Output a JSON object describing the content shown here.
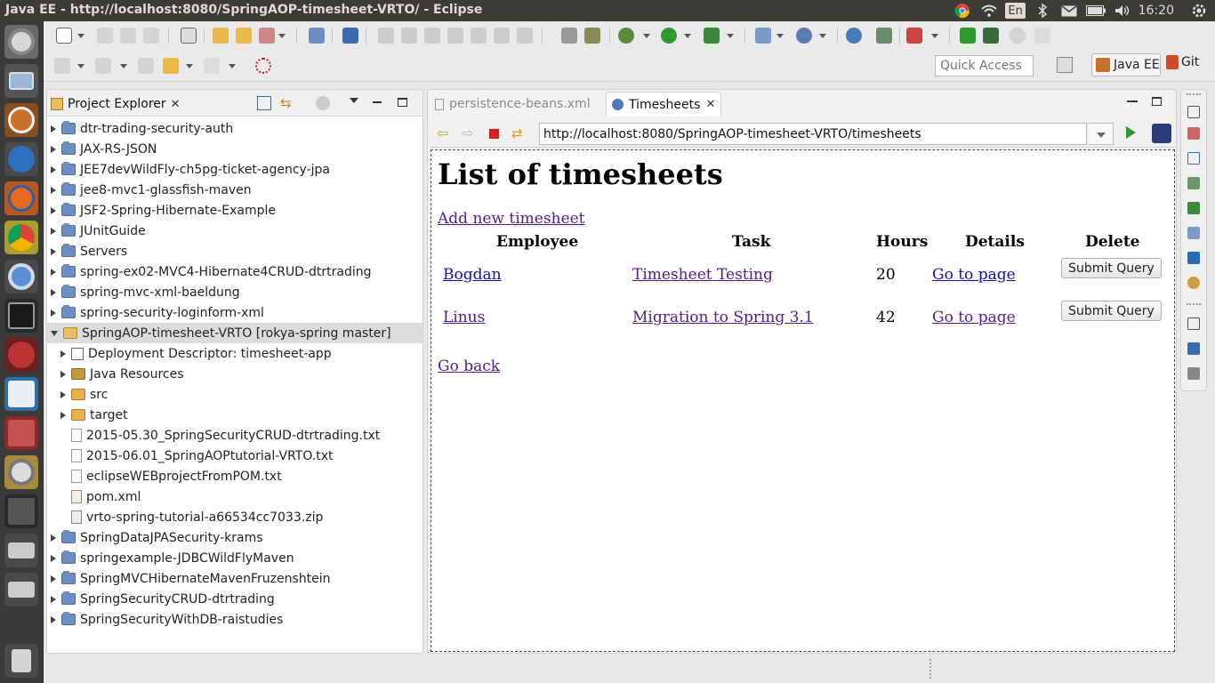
{
  "window": {
    "title": "Java EE - http://localhost:8080/SpringAOP-timesheet-VRTO/ - Eclipse"
  },
  "system_tray": {
    "keyboard_layout": "En",
    "clock": "16:20"
  },
  "toolbar": {
    "quick_access_placeholder": "Quick Access",
    "perspectives": [
      {
        "label": "Java EE",
        "active": true
      },
      {
        "label": "Git",
        "active": false
      }
    ]
  },
  "project_explorer": {
    "title": "Project Explorer",
    "items": [
      {
        "label": "dtr-trading-security-auth",
        "icon": "folder",
        "depth": 0,
        "expand": "closed"
      },
      {
        "label": "JAX-RS-JSON",
        "icon": "folder",
        "depth": 0,
        "expand": "closed"
      },
      {
        "label": "JEE7devWildFly-ch5pg-ticket-agency-jpa",
        "icon": "folder",
        "depth": 0,
        "expand": "closed"
      },
      {
        "label": "jee8-mvc1-glassfish-maven",
        "icon": "folder",
        "depth": 0,
        "expand": "closed"
      },
      {
        "label": "JSF2-Spring-Hibernate-Example",
        "icon": "folder",
        "depth": 0,
        "expand": "closed"
      },
      {
        "label": "JUnitGuide",
        "icon": "folder",
        "depth": 0,
        "expand": "closed"
      },
      {
        "label": "Servers",
        "icon": "folder",
        "depth": 0,
        "expand": "closed"
      },
      {
        "label": "spring-ex02-MVC4-Hibernate4CRUD-dtrtrading",
        "icon": "folder",
        "depth": 0,
        "expand": "closed"
      },
      {
        "label": "spring-mvc-xml-baeldung",
        "icon": "folder",
        "depth": 0,
        "expand": "closed"
      },
      {
        "label": "spring-security-loginform-xml",
        "icon": "folder",
        "depth": 0,
        "expand": "closed"
      },
      {
        "label": "SpringAOP-timesheet-VRTO  [rokya-spring master]",
        "icon": "proj",
        "depth": 0,
        "expand": "open",
        "selected": true
      },
      {
        "label": "Deployment Descriptor: timesheet-app",
        "icon": "dd",
        "depth": 1,
        "expand": "closed"
      },
      {
        "label": "Java Resources",
        "icon": "jr",
        "depth": 1,
        "expand": "closed"
      },
      {
        "label": "src",
        "icon": "src",
        "depth": 1,
        "expand": "closed"
      },
      {
        "label": "target",
        "icon": "src",
        "depth": 1,
        "expand": "closed"
      },
      {
        "label": "2015-05.30_SpringSecurityCRUD-dtrtrading.txt",
        "icon": "plain",
        "depth": 1,
        "expand": "none"
      },
      {
        "label": "2015-06.01_SpringAOPtutorial-VRTO.txt",
        "icon": "plain",
        "depth": 1,
        "expand": "none"
      },
      {
        "label": "eclipseWEBprojectFromPOM.txt",
        "icon": "plain",
        "depth": 1,
        "expand": "none"
      },
      {
        "label": "pom.xml",
        "icon": "xml",
        "depth": 1,
        "expand": "none"
      },
      {
        "label": "vrto-spring-tutorial-a66534cc7033.zip",
        "icon": "zip",
        "depth": 1,
        "expand": "none"
      },
      {
        "label": "SpringDataJPASecurity-krams",
        "icon": "folder",
        "depth": 0,
        "expand": "closed"
      },
      {
        "label": "springexample-JDBCWildFlyMaven",
        "icon": "folder",
        "depth": 0,
        "expand": "closed"
      },
      {
        "label": "SpringMVCHibernateMavenFruzenshtein",
        "icon": "folder",
        "depth": 0,
        "expand": "closed"
      },
      {
        "label": "SpringSecurityCRUD-dtrtrading",
        "icon": "folder",
        "depth": 0,
        "expand": "closed"
      },
      {
        "label": "SpringSecurityWithDB-raistudies",
        "icon": "folder",
        "depth": 0,
        "expand": "closed"
      }
    ]
  },
  "editor": {
    "tabs": [
      {
        "label": "persistence-beans.xml",
        "active": false
      },
      {
        "label": "Timesheets",
        "active": true
      }
    ],
    "browser": {
      "url": "http://localhost:8080/SpringAOP-timesheet-VRTO/timesheets",
      "page": {
        "heading": "List of timesheets",
        "add_link": "Add new timesheet",
        "columns": [
          "Employee",
          "Task",
          "Hours",
          "Details",
          "Delete"
        ],
        "rows": [
          {
            "employee": "Bogdan",
            "task": "Timesheet Testing",
            "hours": "20",
            "details": "Go to page",
            "delete": "Submit Query"
          },
          {
            "employee": "Linus",
            "task": "Migration to Spring 3.1",
            "hours": "42",
            "details": "Go to page",
            "delete": "Submit Query"
          }
        ],
        "back_link": "Go back"
      }
    }
  }
}
